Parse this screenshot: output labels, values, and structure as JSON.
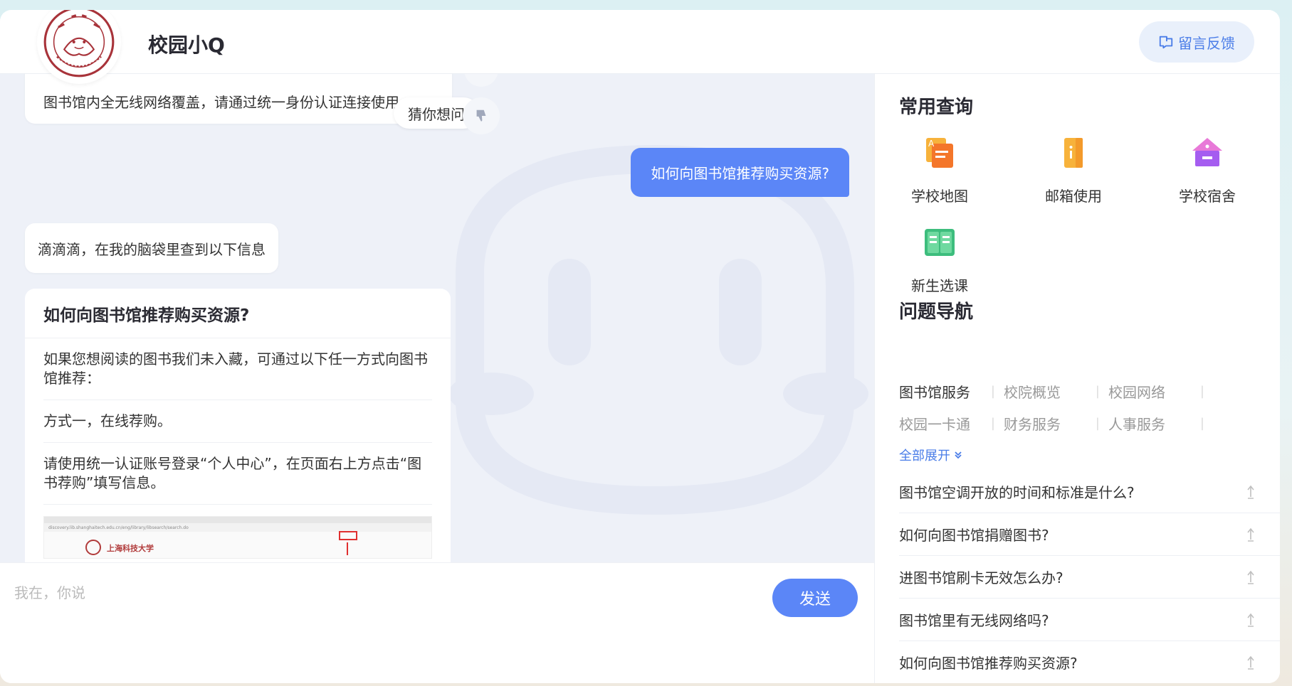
{
  "header": {
    "title": "校园小Q",
    "feedback_label": "留言反馈",
    "logo_text": "SHANGHAITECH UNIVERSITY"
  },
  "chat": {
    "prev_message": "图书馆内全无线网络覆盖，请通过统一身份认证连接使用",
    "guess_label": "猜你想问",
    "user_message": "如何向图书馆推荐购买资源?",
    "bot_message": "滴滴滴，在我的脑袋里查到以下信息",
    "answer": {
      "title": "如何向图书馆推荐购买资源?",
      "p1": "如果您想阅读的图书我们未入藏，可通过以下任一方式向图书馆推荐：",
      "p2": "方式一，在线荐购。",
      "p3": "请使用统一认证账号登录“个人中心”，在页面右上方点击“图书荐购”填写信息。",
      "shot_url": "discovery.lib.shanghaitech.edu.cn/eng/library/libsearch/search.do",
      "shot_school": "上海科技大学"
    }
  },
  "input": {
    "placeholder": "我在，你说",
    "send_label": "发送"
  },
  "side": {
    "quick_title": "常用查询",
    "quick_items": [
      {
        "label": "学校地图",
        "icon": "map-icon"
      },
      {
        "label": "邮箱使用",
        "icon": "mailbox-icon"
      },
      {
        "label": "学校宿舍",
        "icon": "dormitory-icon"
      },
      {
        "label": "新生选课",
        "icon": "course-book-icon"
      }
    ],
    "nav_title": "问题导航",
    "nav_items": [
      "图书馆服务",
      "校院概览",
      "校园网络",
      "校园一卡通",
      "财务服务",
      "人事服务"
    ],
    "expand_label": "全部展开",
    "faqs": [
      "图书馆空调开放的时间和标准是什么?",
      "如何向图书馆捐赠图书?",
      "进图书馆刷卡无效怎么办?",
      "图书馆里有无线网络吗?",
      "如何向图书馆推荐购买资源?"
    ]
  },
  "colors": {
    "accent": "#5b86f7",
    "link": "#4a7de8",
    "chat_bg": "#eef1f8"
  }
}
